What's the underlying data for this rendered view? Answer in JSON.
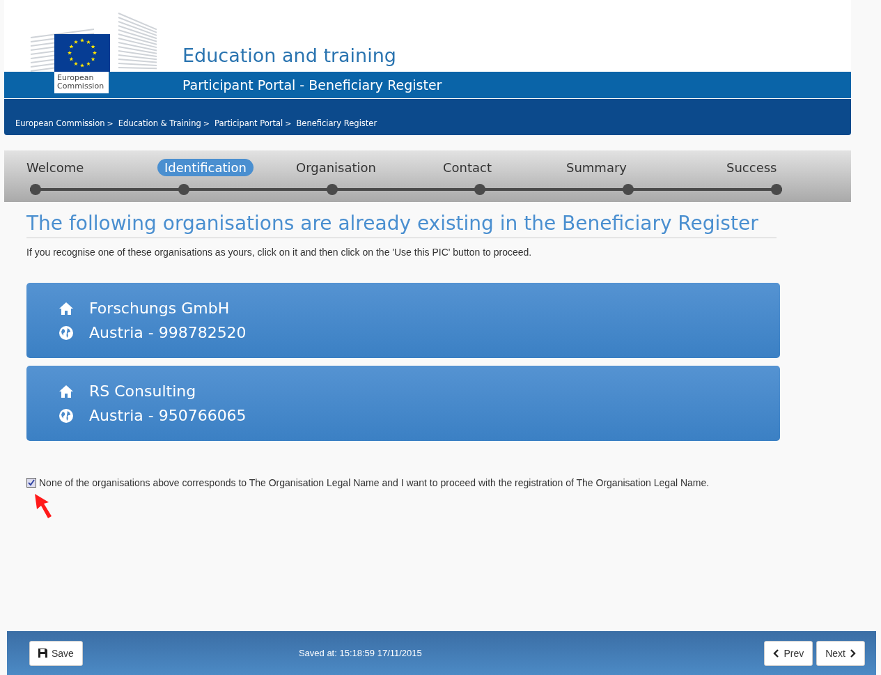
{
  "header": {
    "logo_lines": [
      "European",
      "Commission"
    ],
    "site_title": "Education and training",
    "portal_title": "Participant Portal - Beneficiary Register"
  },
  "breadcrumb": [
    {
      "label": "European Commission",
      "separator": ">"
    },
    {
      "label": "Education & Training",
      "separator": ">"
    },
    {
      "label": "Participant Portal",
      "separator": ">"
    },
    {
      "label": "Beneficiary Register"
    }
  ],
  "steps": [
    {
      "label": "Welcome",
      "selected": false
    },
    {
      "label": "Identification",
      "selected": true
    },
    {
      "label": "Organisation",
      "selected": false
    },
    {
      "label": "Contact",
      "selected": false
    },
    {
      "label": "Summary",
      "selected": false
    },
    {
      "label": "Success",
      "selected": false
    }
  ],
  "heading": "The following organisations are already existing in the Beneficiary Register",
  "intro": "If you recognise one of these organisations as yours, click on it and then click on the 'Use this PIC' button to proceed.",
  "organisations": [
    {
      "name": "Forschungs GmbH",
      "country_pic": "Austria - 998782520"
    },
    {
      "name": "RS Consulting",
      "country_pic": "Austria - 950766065"
    }
  ],
  "none_option": {
    "checked": true,
    "label": "None of the organisations above corresponds to The Organisation Legal Name and I want to proceed with the registration of The Organisation Legal Name."
  },
  "footer": {
    "save": "Save",
    "saved_at": "Saved at: 15:18:59 17/11/2015",
    "prev": "Prev",
    "next": "Next"
  }
}
